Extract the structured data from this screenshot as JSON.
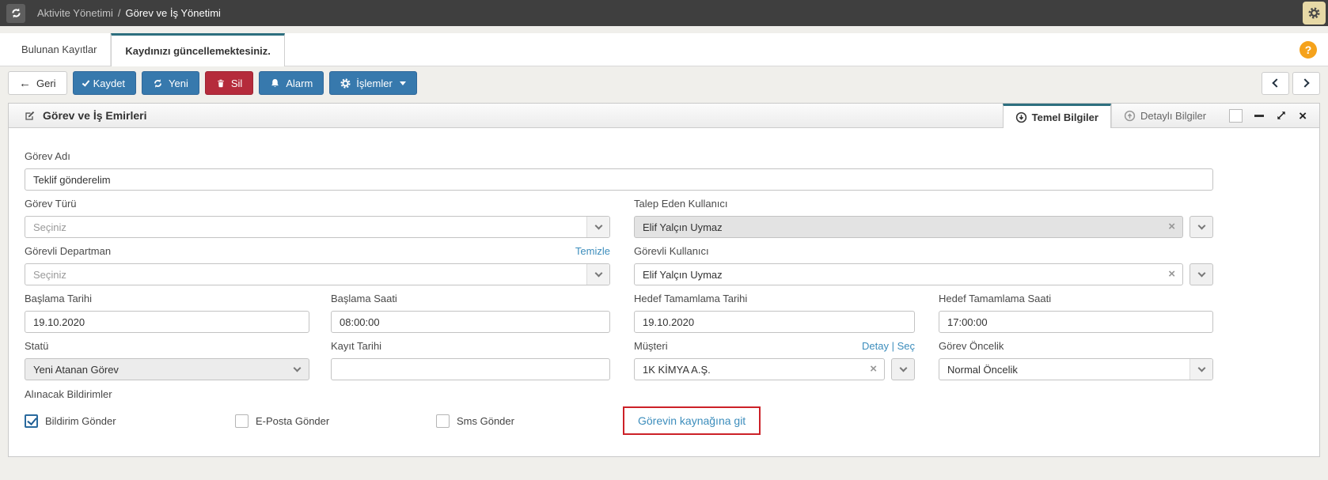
{
  "topbar": {
    "breadcrumb_section": "Aktivite Yönetimi",
    "breadcrumb_sep": "/",
    "breadcrumb_page": "Görev ve İş Yönetimi"
  },
  "record_tabs": {
    "found": "Bulunan Kayıtlar",
    "updating": "Kaydınızı güncellemektesiniz.",
    "help_glyph": "?"
  },
  "toolbar": {
    "back": "Geri",
    "save": "Kaydet",
    "new": "Yeni",
    "delete": "Sil",
    "alarm": "Alarm",
    "actions": "İşlemler"
  },
  "panel": {
    "title": "Görev ve İş Emirleri",
    "tab_basic": "Temel Bilgiler",
    "tab_detail": "Detaylı Bilgiler",
    "close_glyph": "×"
  },
  "form": {
    "gorev_adi": {
      "label": "Görev Adı",
      "value": "Teklif gönderelim"
    },
    "gorev_turu": {
      "label": "Görev Türü",
      "value": "Seçiniz"
    },
    "talep_eden": {
      "label": "Talep Eden Kullanıcı",
      "value": "Elif Yalçın Uymaz",
      "clear_glyph": "×"
    },
    "gorevli_departman": {
      "label": "Görevli Departman",
      "clear_link": "Temizle",
      "value": "Seçiniz"
    },
    "gorevli_kullanici": {
      "label": "Görevli Kullanıcı",
      "value": "Elif Yalçın Uymaz",
      "clear_glyph": "×"
    },
    "baslama_tarihi": {
      "label": "Başlama Tarihi",
      "value": "19.10.2020"
    },
    "baslama_saati": {
      "label": "Başlama Saati",
      "value": "08:00:00"
    },
    "hedef_tarihi": {
      "label": "Hedef Tamamlama Tarihi",
      "value": "19.10.2020"
    },
    "hedef_saati": {
      "label": "Hedef Tamamlama Saati",
      "value": "17:00:00"
    },
    "statu": {
      "label": "Statü",
      "value": "Yeni Atanan Görev"
    },
    "kayit_tarihi": {
      "label": "Kayıt Tarihi",
      "value": ""
    },
    "musteri": {
      "label": "Müşteri",
      "detail_link": "Detay",
      "link_sep": "|",
      "select_link": "Seç",
      "value": "1K KİMYA A.Ş.",
      "clear_glyph": "×"
    },
    "oncelik": {
      "label": "Görev Öncelik",
      "value": "Normal Öncelik"
    },
    "bildirimler": {
      "label": "Alınacak Bildirimler",
      "checkboxes": [
        {
          "label": "Bildirim Gönder",
          "checked": true
        },
        {
          "label": "E-Posta Gönder",
          "checked": false
        },
        {
          "label": "Sms Gönder",
          "checked": false
        }
      ],
      "source_link": "Görevin kaynağına git"
    }
  },
  "colors": {
    "topbar_bg": "#3f3f3f",
    "page_bg": "#f0efeb",
    "accent_blue": "#3779ad",
    "danger_red": "#b52b3b",
    "link_blue": "#3c8dbc",
    "tab_teal": "#2d6f7f",
    "help_orange": "#f5a21b",
    "highlight_red": "#cc2128",
    "settings_tan": "#e7d9a6"
  }
}
